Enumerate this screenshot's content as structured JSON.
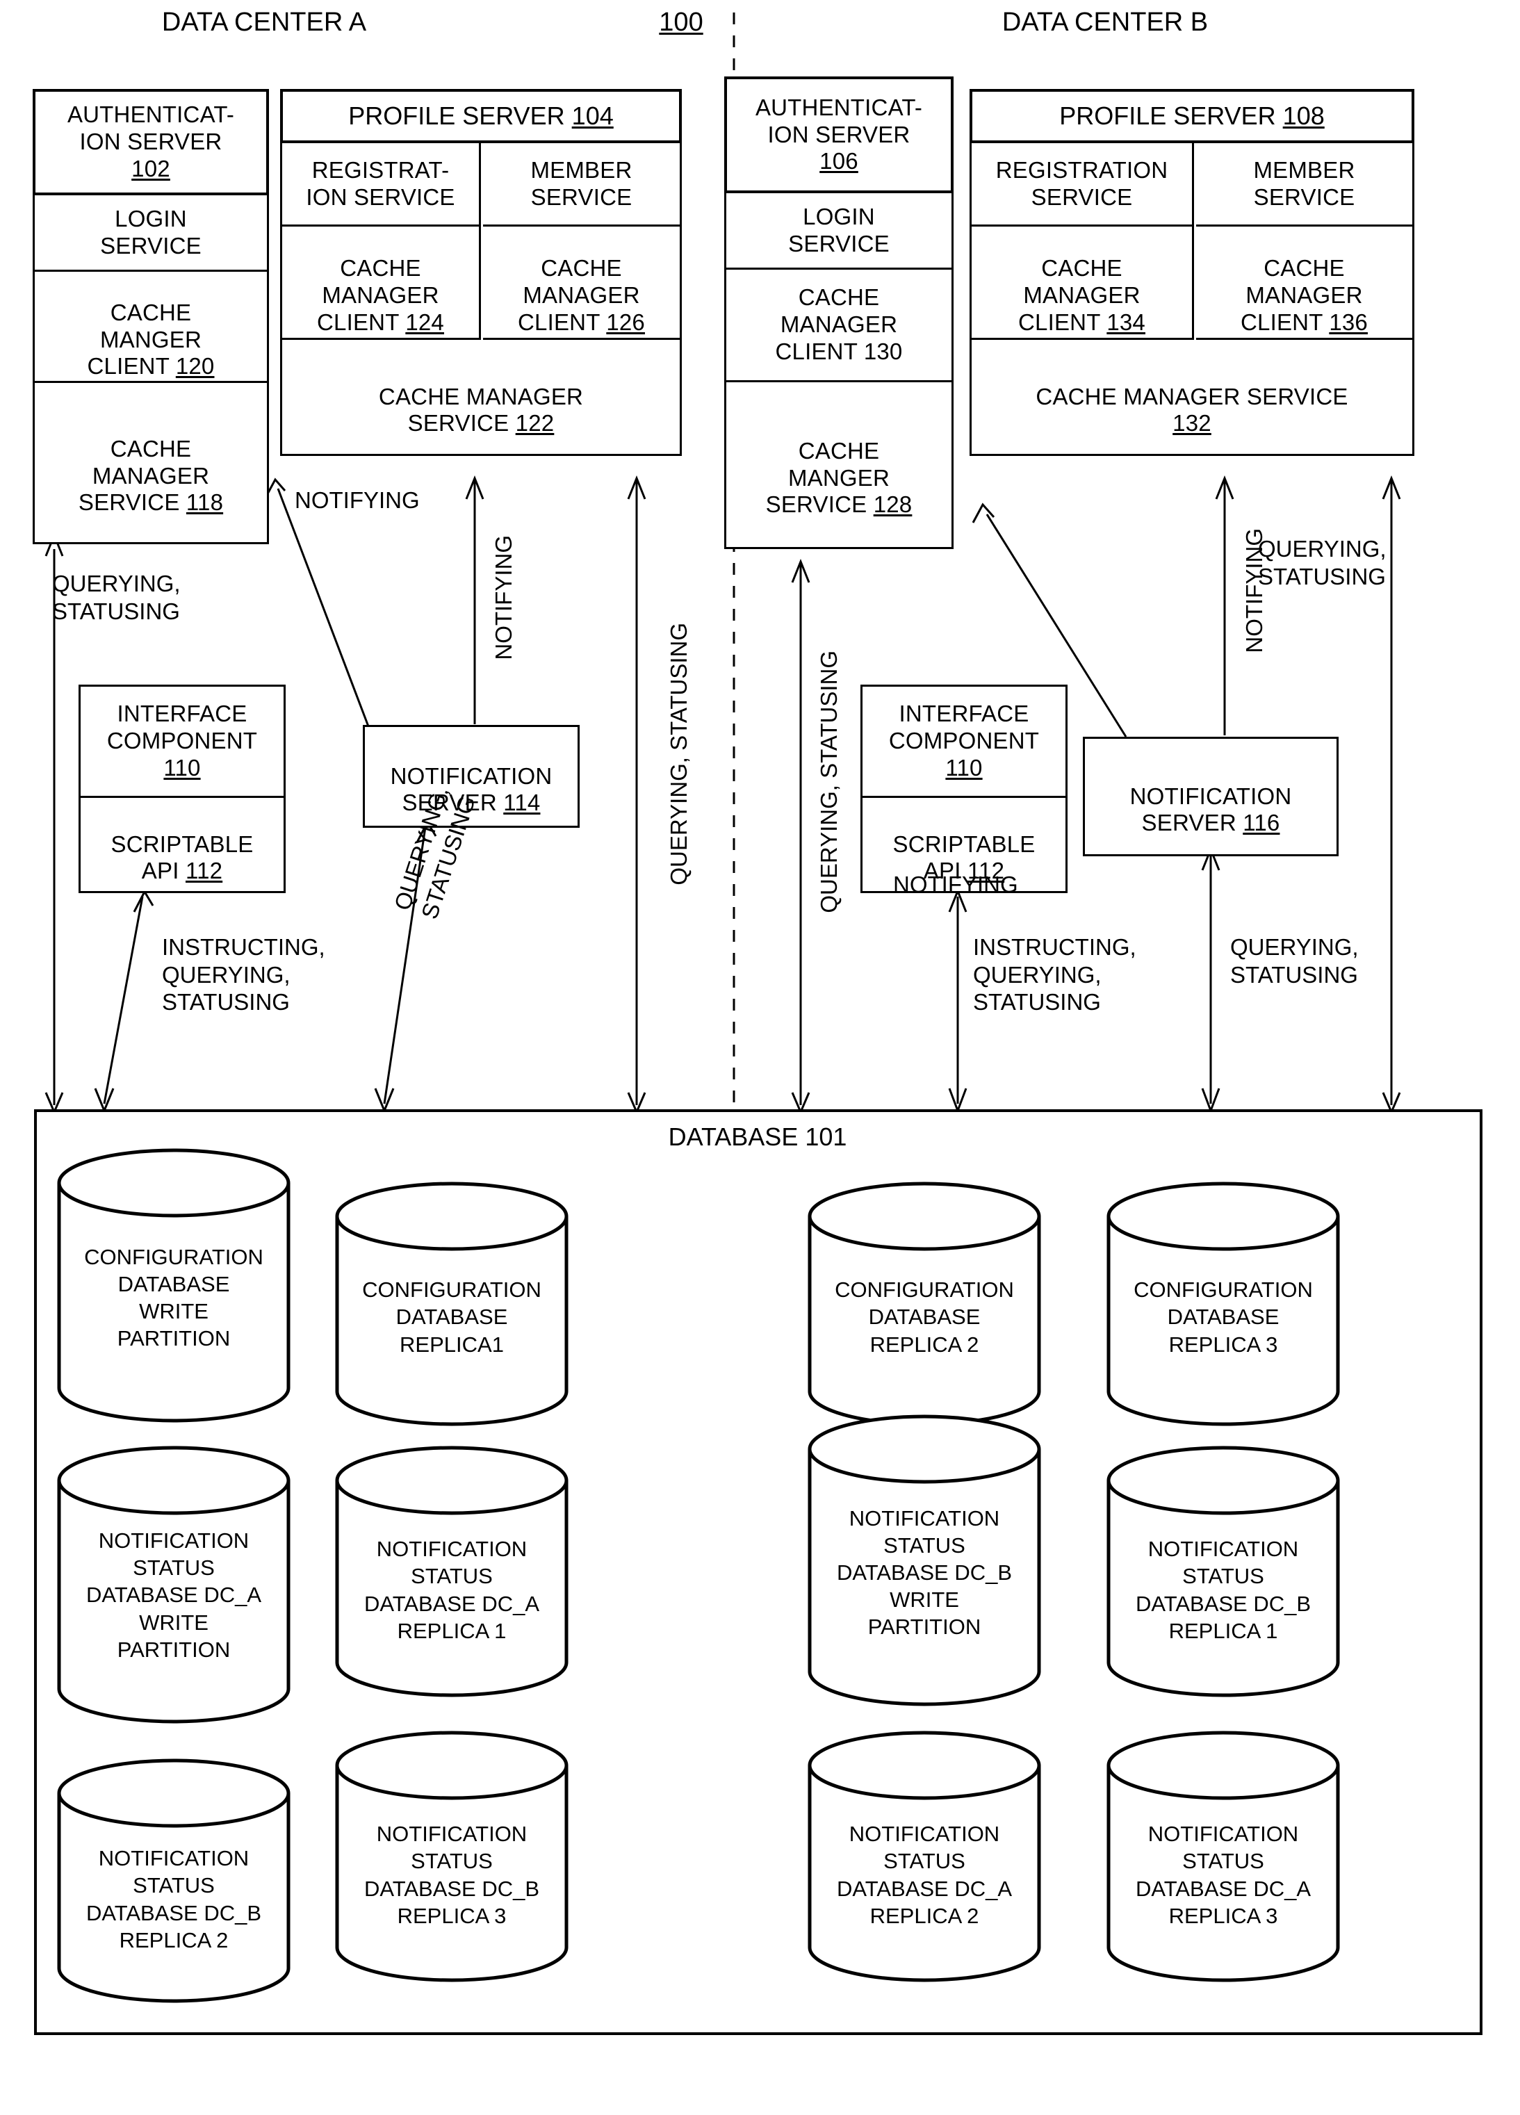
{
  "figure": {
    "reference_numeral": "100",
    "dc_a_title": "DATA CENTER A",
    "dc_b_title": "DATA CENTER B"
  },
  "data_center_a": {
    "authentication_server": {
      "title": "AUTHENTICAT-\nION SERVER",
      "ref": "102",
      "rows": [
        "LOGIN\nSERVICE",
        "CACHE\nMANGER\nCLIENT ",
        "CACHE\nMANAGER\nSERVICE "
      ],
      "cache_manager_client_ref": "120",
      "cache_manager_service_ref": "118"
    },
    "profile_server": {
      "title": "PROFILE SERVER ",
      "ref": "104",
      "registration_service": "REGISTRAT-\nION SERVICE",
      "member_service": "MEMBER\nSERVICE",
      "cache_manager_client_left": "CACHE\nMANAGER\nCLIENT ",
      "cache_manager_client_left_ref": "124",
      "cache_manager_client_right": "CACHE\nMANAGER\nCLIENT ",
      "cache_manager_client_right_ref": "126",
      "cache_manager_service": "CACHE MANAGER\nSERVICE ",
      "cache_manager_service_ref": "122"
    },
    "interface_component": {
      "title": "INTERFACE\nCOMPONENT",
      "ref": "110",
      "api_label": "SCRIPTABLE\nAPI ",
      "api_ref": "112"
    },
    "notification_server": {
      "title": "NOTIFICATION\nSERVER ",
      "ref": "114"
    },
    "edge_labels": {
      "auth_query": "QUERYING,\nSTATUSING",
      "notif_to_profile_diagonal": "NOTIFYING",
      "notif_vertical": "NOTIFYING",
      "profile_to_db": "QUERYING, STATUSING",
      "iface_to_db": "INSTRUCTING,\nQUERYING,\nSTATUSING",
      "notif_to_db": "QUERYING,\nSTATUSING"
    }
  },
  "data_center_b": {
    "authentication_server": {
      "title": "AUTHENTICAT-\nION SERVER",
      "ref": "106",
      "rows": [
        "LOGIN\nSERVICE",
        "CACHE\nMANAGER\nCLIENT 130",
        "CACHE\nMANGER\nSERVICE "
      ],
      "cache_manager_service_ref": "128"
    },
    "profile_server": {
      "title": "PROFILE SERVER ",
      "ref": "108",
      "registration_service": "REGISTRATION\nSERVICE",
      "member_service": "MEMBER\nSERVICE",
      "cache_manager_client_left": "CACHE\nMANAGER\nCLIENT ",
      "cache_manager_client_left_ref": "134",
      "cache_manager_client_right": "CACHE\nMANAGER\nCLIENT ",
      "cache_manager_client_right_ref": "136",
      "cache_manager_service": "CACHE MANAGER SERVICE\n",
      "cache_manager_service_ref": "132"
    },
    "interface_component": {
      "title": "INTERFACE\nCOMPONENT",
      "ref": "110",
      "api_label": "SCRIPTABLE\nAPI ",
      "api_ref": "112"
    },
    "notification_server": {
      "title": "NOTIFICATION\nSERVER ",
      "ref": "116"
    },
    "edge_labels": {
      "auth_query": "QUERYING, STATUSING",
      "notif_to_auth_diagonal": "NOTIFYING",
      "notif_vertical": "NOTIFYING",
      "profile_query": "QUERYING,\nSTATUSING",
      "iface_to_db": "INSTRUCTING,\nQUERYING,\nSTATUSING",
      "notif_to_db": "QUERYING,\nSTATUSING"
    }
  },
  "database": {
    "label": "DATABASE 101",
    "cylinders": [
      {
        "text": "CONFIGURATION\nDATABASE\nWRITE\nPARTITION"
      },
      {
        "text": "CONFIGURATION\nDATABASE\nREPLICA1"
      },
      {
        "text": "CONFIGURATION\nDATABASE\nREPLICA 2"
      },
      {
        "text": "CONFIGURATION\nDATABASE\nREPLICA 3"
      },
      {
        "text": "NOTIFICATION\nSTATUS\nDATABASE DC_A\nWRITE\nPARTITION"
      },
      {
        "text": "NOTIFICATION\nSTATUS\nDATABASE DC_A\nREPLICA 1"
      },
      {
        "text": "NOTIFICATION\nSTATUS\nDATABASE DC_B\nWRITE\nPARTITION"
      },
      {
        "text": "NOTIFICATION\nSTATUS\nDATABASE DC_B\nREPLICA 1"
      },
      {
        "text": "NOTIFICATION\nSTATUS\nDATABASE DC_B\nREPLICA 2"
      },
      {
        "text": "NOTIFICATION\nSTATUS\nDATABASE DC_B\nREPLICA 3"
      },
      {
        "text": "NOTIFICATION\nSTATUS\nDATABASE DC_A\nREPLICA 2"
      },
      {
        "text": "NOTIFICATION\nSTATUS\nDATABASE DC_A\nREPLICA 3"
      }
    ]
  },
  "colors": {
    "ink": "#000000",
    "paper": "#ffffff"
  }
}
